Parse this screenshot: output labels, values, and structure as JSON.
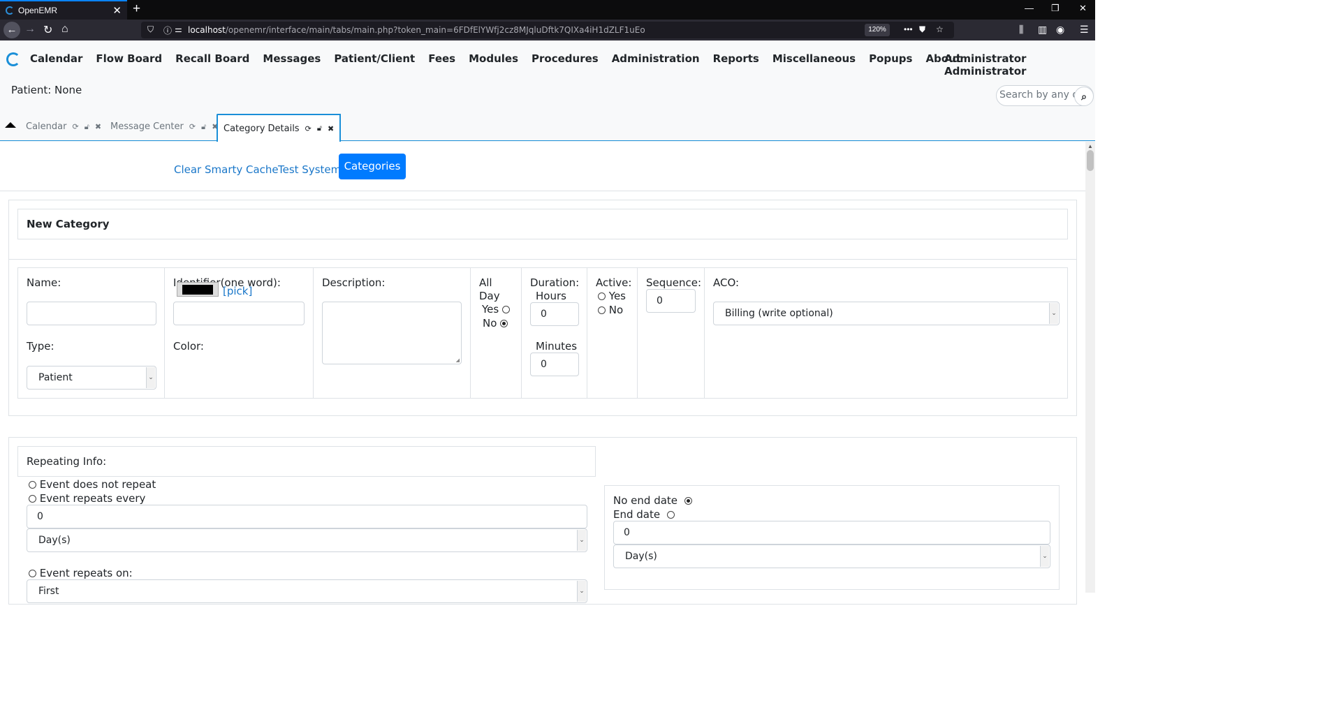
{
  "browser": {
    "tab_title": "OpenEMR",
    "url_host": "localhost",
    "url_path": "/openemr/interface/main/tabs/main.php?token_main=6FDfElYWfj2cz8MJqluDftk7QIXa4iH1dZLF1uEo",
    "zoom": "120%"
  },
  "menu": {
    "items": [
      "Calendar",
      "Flow Board",
      "Recall Board",
      "Messages",
      "Patient/Client",
      "Fees",
      "Modules",
      "Procedures",
      "Administration",
      "Reports",
      "Miscellaneous",
      "Popups",
      "About"
    ],
    "user": "Administrator Administrator"
  },
  "patient_label": "Patient: None",
  "search_placeholder": "Search by any demographics",
  "tabs": [
    {
      "label": "Calendar",
      "active": false
    },
    {
      "label": "Message Center",
      "active": false
    },
    {
      "label": "Category Details",
      "active": true
    }
  ],
  "toolbar": {
    "clear_cache": "Clear Smarty Cache",
    "test_system": "Test System",
    "categories": "Categories"
  },
  "form": {
    "title": "New Category",
    "name_label": "Name:",
    "identifier_label": "Identifier(one word):",
    "description_label": "Description:",
    "allday_label_1": "All",
    "allday_label_2": "Day",
    "allday_yes": "Yes",
    "allday_no": "No",
    "duration_label": "Duration:",
    "hours_label": "Hours",
    "hours_value": "0",
    "minutes_label": "Minutes",
    "minutes_value": "0",
    "active_label": "Active:",
    "active_yes": "Yes",
    "active_no": "No",
    "sequence_label": "Sequence:",
    "sequence_value": "0",
    "aco_label": "ACO:",
    "aco_value": "Billing (write optional)",
    "type_label": "Type:",
    "type_value": "Patient",
    "color_label": "Color:",
    "color_value": "#000000",
    "pick_label": "[pick]"
  },
  "repeat": {
    "title": "Repeating Info:",
    "no_repeat": "Event does not repeat",
    "repeat_every": "Event repeats every",
    "every_value": "0",
    "every_unit": "Day(s)",
    "repeat_on": "Event repeats on:",
    "on_value": "First",
    "no_end": "No end date",
    "end_date": "End date",
    "end_value": "0",
    "end_unit": "Day(s)"
  }
}
